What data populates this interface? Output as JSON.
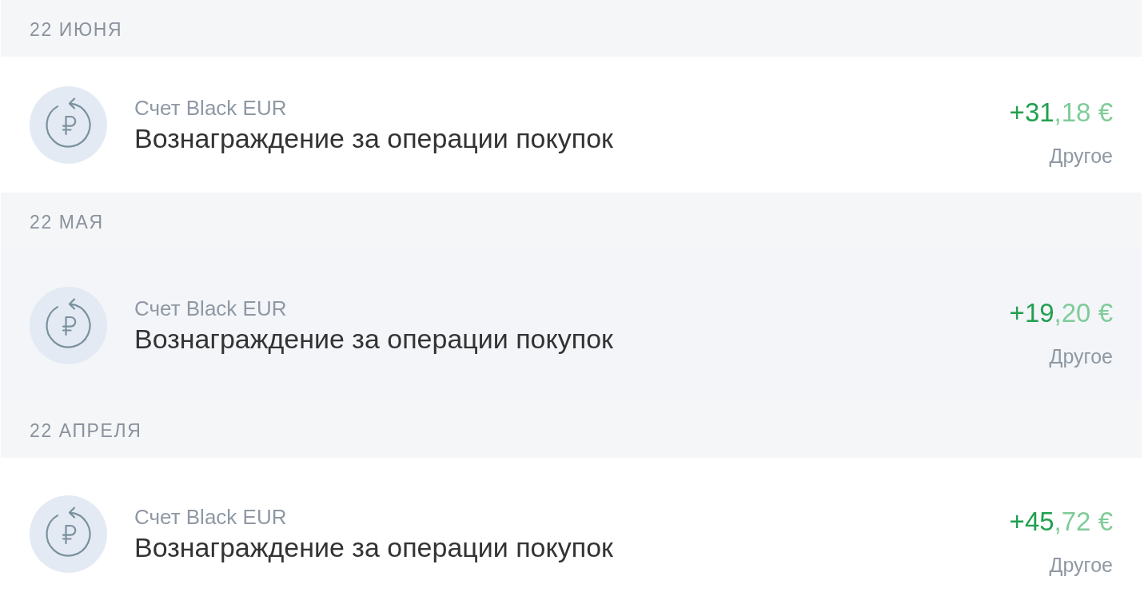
{
  "groups": [
    {
      "date": "22 ИЮНЯ",
      "operations": [
        {
          "account": "Счет Black EUR",
          "title": "Вознаграждение за операции покупок",
          "amount": {
            "whole": "+31",
            "fraction": ",18 €"
          },
          "category": "Другое",
          "highlighted": false
        }
      ]
    },
    {
      "date": "22 МАЯ",
      "operations": [
        {
          "account": "Счет Black EUR",
          "title": "Вознаграждение за операции покупок",
          "amount": {
            "whole": "+19",
            "fraction": ",20 €"
          },
          "category": "Другое",
          "highlighted": true
        }
      ]
    },
    {
      "date": "22 АПРЕЛЯ",
      "operations": [
        {
          "account": "Счет Black EUR",
          "title": "Вознаграждение за операции покупок",
          "amount": {
            "whole": "+45",
            "fraction": ",72 €"
          },
          "category": "Другое",
          "highlighted": false
        }
      ]
    }
  ]
}
